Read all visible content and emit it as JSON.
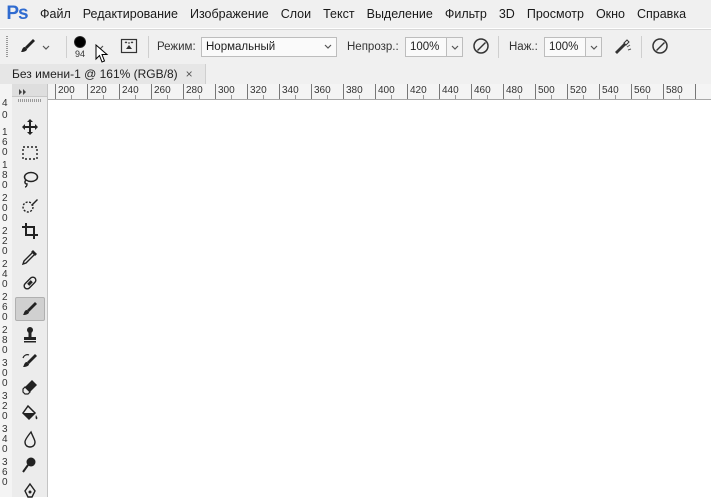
{
  "app": {
    "logo": "Ps",
    "menu": [
      "Файл",
      "Редактирование",
      "Изображение",
      "Слои",
      "Текст",
      "Выделение",
      "Фильтр",
      "3D",
      "Просмотр",
      "Окно",
      "Справка"
    ]
  },
  "options": {
    "brush_size": "94",
    "mode_label": "Режим:",
    "mode_value": "Нормальный",
    "opacity_label": "Непрозр.:",
    "opacity_value": "100%",
    "flow_label": "Наж.:",
    "flow_value": "100%"
  },
  "document": {
    "tab_title": "Без имени-1 @ 161% (RGB/8)",
    "close_symbol": "×"
  },
  "rulers": {
    "horizontal": [
      "200",
      "220",
      "240",
      "260",
      "280",
      "300",
      "320",
      "340",
      "360",
      "380",
      "400",
      "420",
      "440",
      "460",
      "480",
      "500",
      "520",
      "540",
      "560",
      "580"
    ],
    "vertical": [
      "4",
      "0",
      "1",
      "6",
      "0",
      "1",
      "8",
      "0",
      "2",
      "0",
      "0",
      "2",
      "2",
      "0",
      "2",
      "4",
      "0",
      "2",
      "6",
      "0",
      "2",
      "8",
      "0",
      "3",
      "0",
      "0",
      "3",
      "2",
      "0",
      "3",
      "4",
      "0",
      "3",
      "6",
      "0"
    ]
  },
  "toolbar": {
    "tools": [
      "move-tool",
      "marquee-tool",
      "lasso-tool",
      "quick-select-tool",
      "crop-tool",
      "eyedropper-tool",
      "healing-brush-tool",
      "brush-tool",
      "clone-stamp-tool",
      "history-brush-tool",
      "eraser-tool",
      "paint-bucket-tool",
      "blur-tool",
      "dodge-tool",
      "pen-tool"
    ],
    "active_tool": "brush-tool"
  }
}
